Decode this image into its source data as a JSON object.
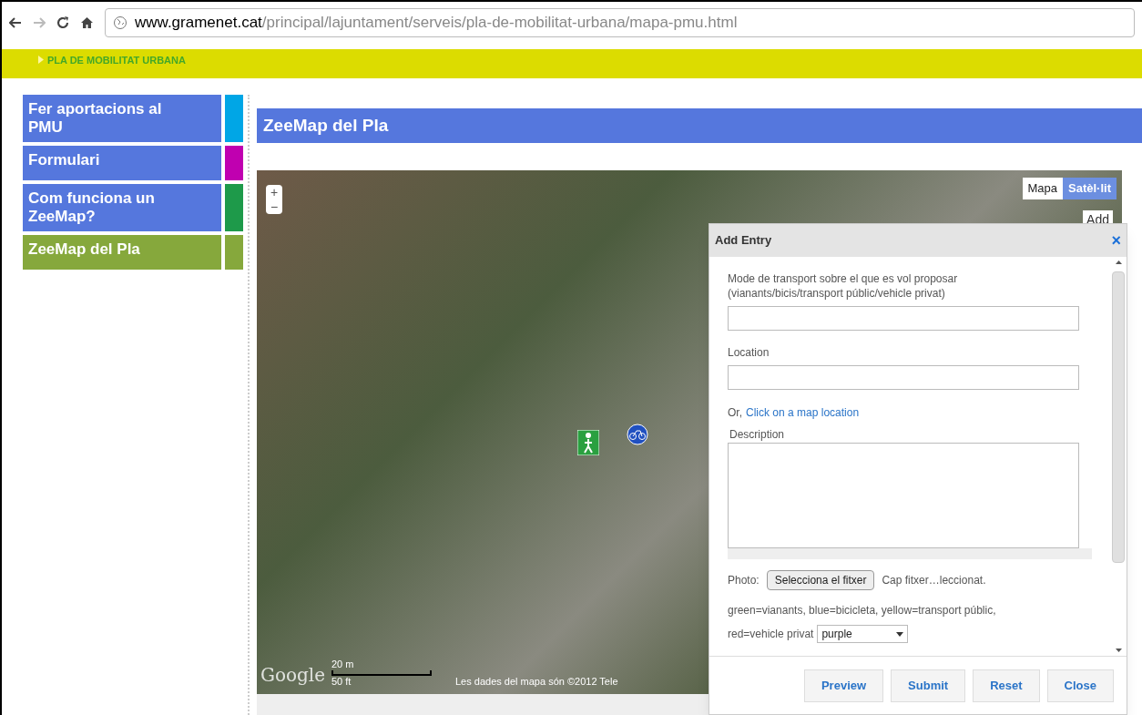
{
  "browser": {
    "url_host": "www.gramenet.cat",
    "url_path": "/principal/lajuntament/serveis/pla-de-mobilitat-urbana/mapa-pmu.html"
  },
  "breadcrumb": "PLA DE MOBILITAT URBANA",
  "sidebar": {
    "items": [
      {
        "label": "Fer aportacions al PMU",
        "color": "#00a6e6",
        "selected": false
      },
      {
        "label": "Formulari",
        "color": "#c000b0",
        "selected": false
      },
      {
        "label": "Com funciona un ZeeMap?",
        "color": "#1e9a4a",
        "selected": false
      },
      {
        "label": "ZeeMap del Pla",
        "color": "#86a83c",
        "selected": true
      }
    ]
  },
  "content": {
    "title": "ZeeMap del Pla",
    "map": {
      "zoom_in": "+",
      "zoom_out": "−",
      "type_tabs": [
        {
          "label": "Mapa",
          "selected": false
        },
        {
          "label": "Satèl·lit",
          "selected": true
        }
      ],
      "add_button": "Add",
      "logo": "Google",
      "scale": [
        "20 m",
        "50 ft"
      ],
      "attribution": "Les dades del mapa són ©2012 Tele"
    },
    "dialog": {
      "title": "Add Entry",
      "close": "×",
      "fields": [
        {
          "kind": "text",
          "label": "Mode de transport sobre el que es vol proposar (vianants/bicis/transport públic/vehicle privat)"
        },
        {
          "kind": "text",
          "label": "Location"
        }
      ],
      "or_text": "Or,",
      "map_link": "Click on a map location",
      "description_label": "Description",
      "photo_label": "Photo:",
      "file_button": "Selecciona el fitxer",
      "file_status": "Cap fitxer…leccionat.",
      "legend": [
        "green=vianants, blue=bicicleta, yellow=transport públic,",
        "red=vehicle privat"
      ],
      "color_select": "purple",
      "buttons": [
        "Preview",
        "Submit",
        "Reset",
        "Close"
      ]
    }
  }
}
